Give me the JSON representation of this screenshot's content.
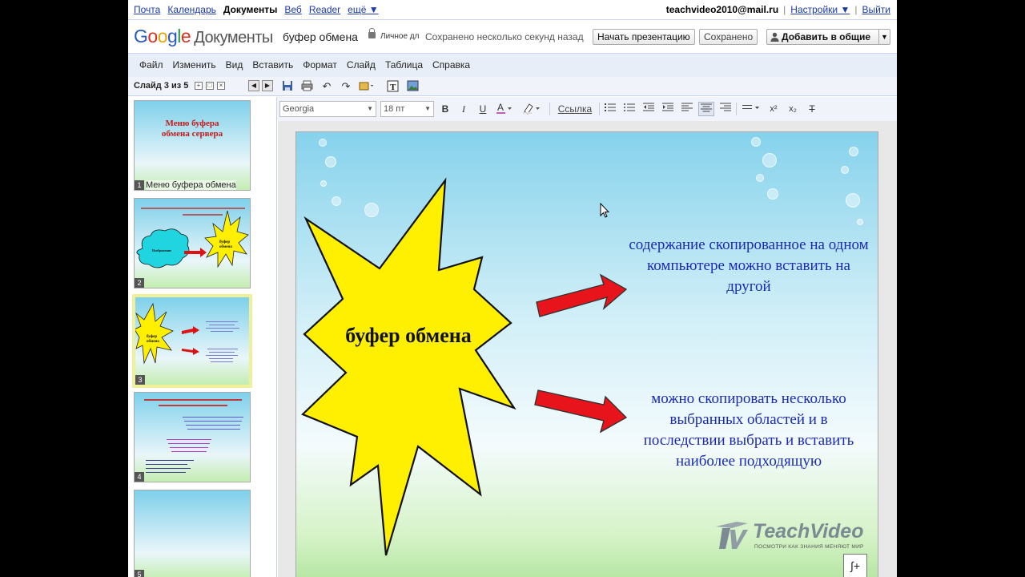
{
  "gbar": {
    "links": [
      "Почта",
      "Календарь",
      "Документы",
      "Веб",
      "Reader",
      "ещё ▼"
    ],
    "active": "Документы",
    "user": "teachvideo2010@mail.ru",
    "settings": "Настройки ▼",
    "logout": "Выйти"
  },
  "header": {
    "logo_docs": "Документы",
    "doc_title": "буфер обмена",
    "privacy": "Личное дл",
    "save_status": "Сохранено несколько секунд назад",
    "present_button": "Начать презентацию",
    "saved_button": "Сохранено",
    "share_button": "Добавить в общие"
  },
  "menu": [
    "Файл",
    "Изменить",
    "Вид",
    "Вставить",
    "Формат",
    "Слайд",
    "Таблица",
    "Справка"
  ],
  "slidebar": {
    "count": "Слайд 3 из 5"
  },
  "format_toolbar": {
    "font": "Georgia",
    "size": "18 пт",
    "link": "Ссылка",
    "bold": "B",
    "italic": "I",
    "underline": "U"
  },
  "filmstrip": {
    "thumbs": [
      {
        "num": "1",
        "caption": "Меню буфера обмена",
        "title": "Меню буфера обмена сервера"
      },
      {
        "num": "2",
        "caption": ""
      },
      {
        "num": "3",
        "caption": "",
        "star": "буфер обмена"
      },
      {
        "num": "4",
        "caption": ""
      },
      {
        "num": "5",
        "caption": ""
      }
    ]
  },
  "slide": {
    "star_text": "буфер обмена",
    "text1": "содержание скопированное на одном компьютере можно вставить на другой",
    "text2": "можно скопировать несколько выбранных областей и в последствии выбрать и вставить наиболее подходящую",
    "watermark": "TeachVideo",
    "watermark_tag": "ПОСМОТРИ КАК ЗНАНИЯ МЕНЯЮТ МИР",
    "colors": {
      "star": "#ffef00",
      "arrow": "#e8141b",
      "text": "#1a2ab5"
    }
  }
}
